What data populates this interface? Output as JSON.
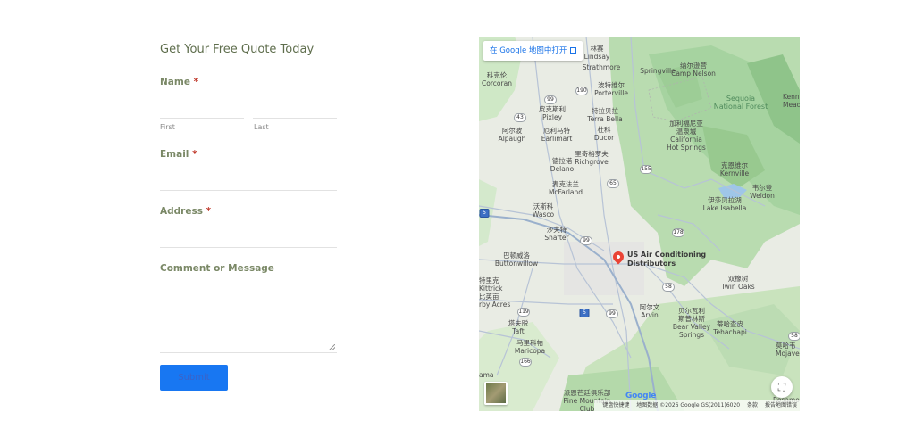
{
  "form": {
    "title": "Get Your Free Quote Today",
    "name_label": "Name",
    "first_label": "First",
    "last_label": "Last",
    "email_label": "Email",
    "address_label": "Address",
    "comment_label": "Comment or Message",
    "required_mark": "*",
    "submit_label": "Submit"
  },
  "map": {
    "open_in_maps": "在 Google 地图中打开",
    "place_name_line1": "US Air Conditioning",
    "place_name_line2": "Distributors",
    "google_logo": "Google",
    "attrib_shortcuts": "键盘快捷键",
    "attrib_data": "地图数据 ©2026 Google GS(2011)6020",
    "attrib_terms": "条款",
    "attrib_report": "报告地图错误",
    "labels": {
      "kings": "科克伦\nCorcoran",
      "lindsay": "林赛\nLindsay",
      "strathmore": "Strathmore",
      "springville": "Springville",
      "campnelson": "纳尔逊营\nCamp Nelson",
      "porterville": "波特维尔\nPorterville",
      "sequoia": "Sequoia\nNational Forest",
      "kenn": "Kenn\nMead",
      "pixley": "皮克斯利\nPixley",
      "terrabella": "特拉贝拉\nTerra Bella",
      "alpaugh": "阿尔波\nAlpaugh",
      "earlimart": "厄利马特\nEarlimart",
      "ducor": "杜科\nDucor",
      "calhot": "加利福尼亚\n温泉城\nCalifornia\nHot Springs",
      "delano": "德拉诺\nDelano",
      "richgrove": "里奇格罗夫\nRichgrove",
      "kernville": "克恩维尔\nKernville",
      "weldon": "韦尔登\nWeldon",
      "mcfarland": "麦克法兰\nMcFarland",
      "lakeisabella": "伊莎贝拉湖\nLake Isabella",
      "wasco": "沃斯科\nWasco",
      "shafter": "沙夫特\nShafter",
      "buttonwillow": "巴顿威洛\nButtonwillow",
      "twinoaks": "双橡树\nTwin Oaks",
      "kittrick": "特里克\nKittrick",
      "derby": "比英亩\nrby Acres",
      "arvin": "阿尔文\nArvin",
      "bearvalley": "贝尔瓦利\n斯普林斯\nBear Valley\nSprings",
      "tehachapi": "蒂哈查皮\nTehachapi",
      "taft": "塔夫脱\nTaft",
      "maricopa": "马里科帕\nMaricopa",
      "mojave": "莫哈韦\nMojave",
      "rosamond": "Rosamor",
      "pinemountain": "派恩芒廷俱乐部\nPine Mountain\nClub",
      "gama": "ama"
    },
    "shields": [
      "43",
      "99",
      "190",
      "65",
      "155",
      "99",
      "178",
      "58",
      "119",
      "58",
      "166",
      "5",
      "5",
      "99"
    ]
  }
}
